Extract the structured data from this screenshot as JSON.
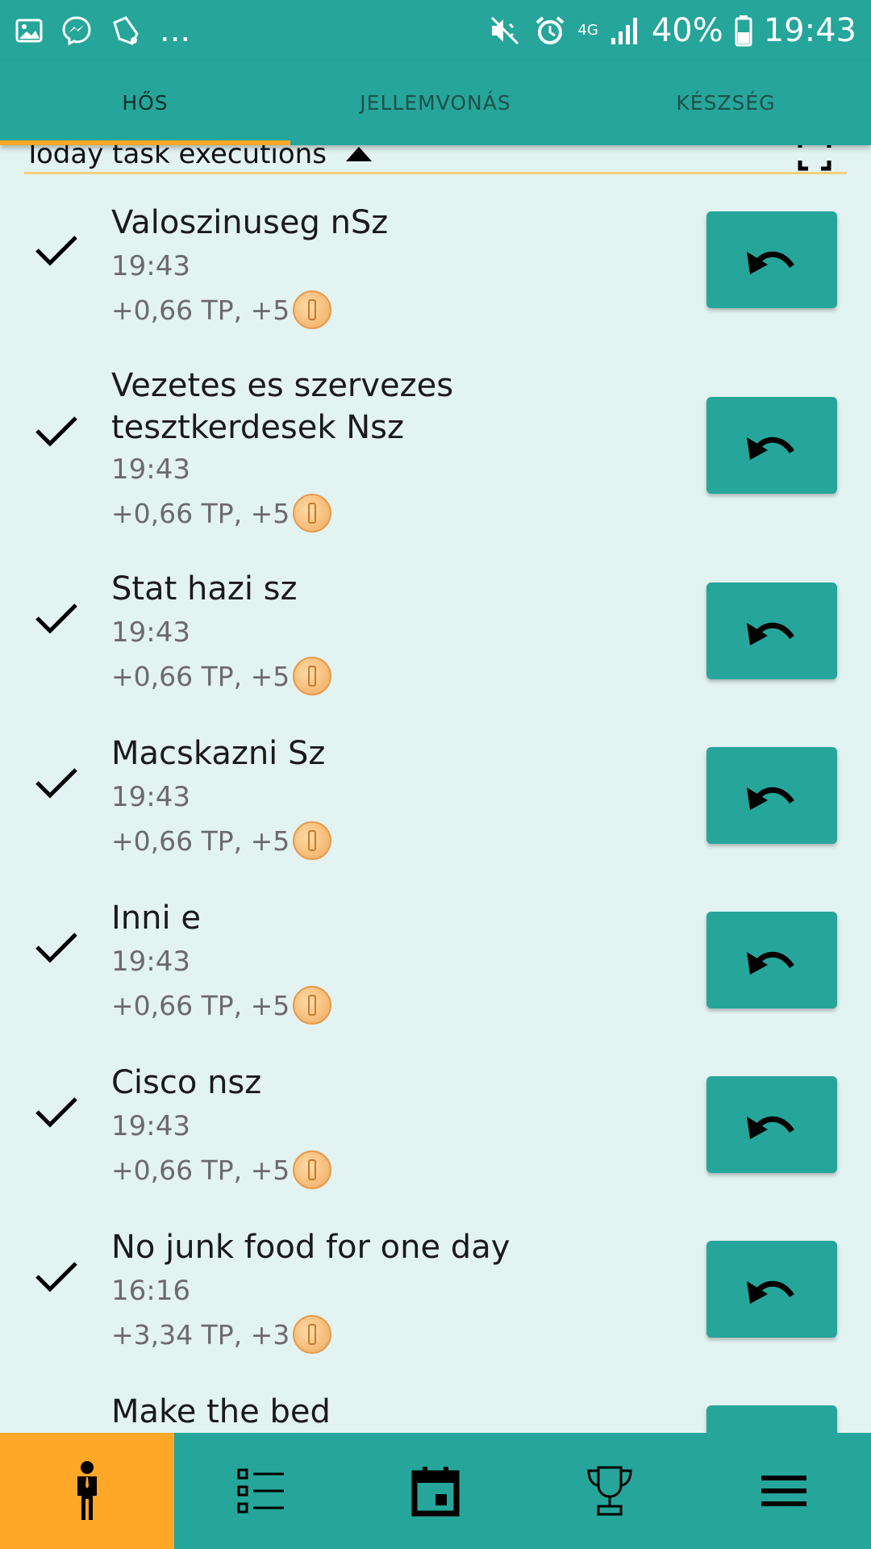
{
  "status_bar": {
    "battery": "40%",
    "clock": "19:43",
    "network": "4G",
    "more": "..."
  },
  "tabs": [
    {
      "label": "HŐS",
      "active": true
    },
    {
      "label": "JELLEMVONÁS",
      "active": false
    },
    {
      "label": "KÉSZSÉG",
      "active": false
    }
  ],
  "section": {
    "title": "Today task executions"
  },
  "tasks": [
    {
      "name": "Valoszinuseg nSz",
      "time": "19:43",
      "reward": "+0,66 TP, +5"
    },
    {
      "name": "Vezetes es szervezes tesztkerdesek Nsz",
      "time": "19:43",
      "reward": "+0,66 TP, +5"
    },
    {
      "name": "Stat hazi sz",
      "time": "19:43",
      "reward": "+0,66 TP, +5"
    },
    {
      "name": "Macskazni Sz",
      "time": "19:43",
      "reward": "+0,66 TP, +5"
    },
    {
      "name": "Inni e",
      "time": "19:43",
      "reward": "+0,66 TP, +5"
    },
    {
      "name": "Cisco nsz",
      "time": "19:43",
      "reward": "+0,66 TP, +5"
    },
    {
      "name": "No junk food for one day",
      "time": "16:16",
      "reward": "+3,34 TP, +3"
    },
    {
      "name": "Make the bed",
      "time": "",
      "reward": ""
    }
  ],
  "bottom_nav": [
    {
      "icon": "hero-person-icon",
      "active": true
    },
    {
      "icon": "task-list-icon",
      "active": false
    },
    {
      "icon": "calendar-icon",
      "active": false
    },
    {
      "icon": "trophy-icon",
      "active": false
    },
    {
      "icon": "menu-icon",
      "active": false
    }
  ],
  "colors": {
    "primary": "#26a69a",
    "accent": "#ffa726",
    "background": "#e3f3f1"
  }
}
